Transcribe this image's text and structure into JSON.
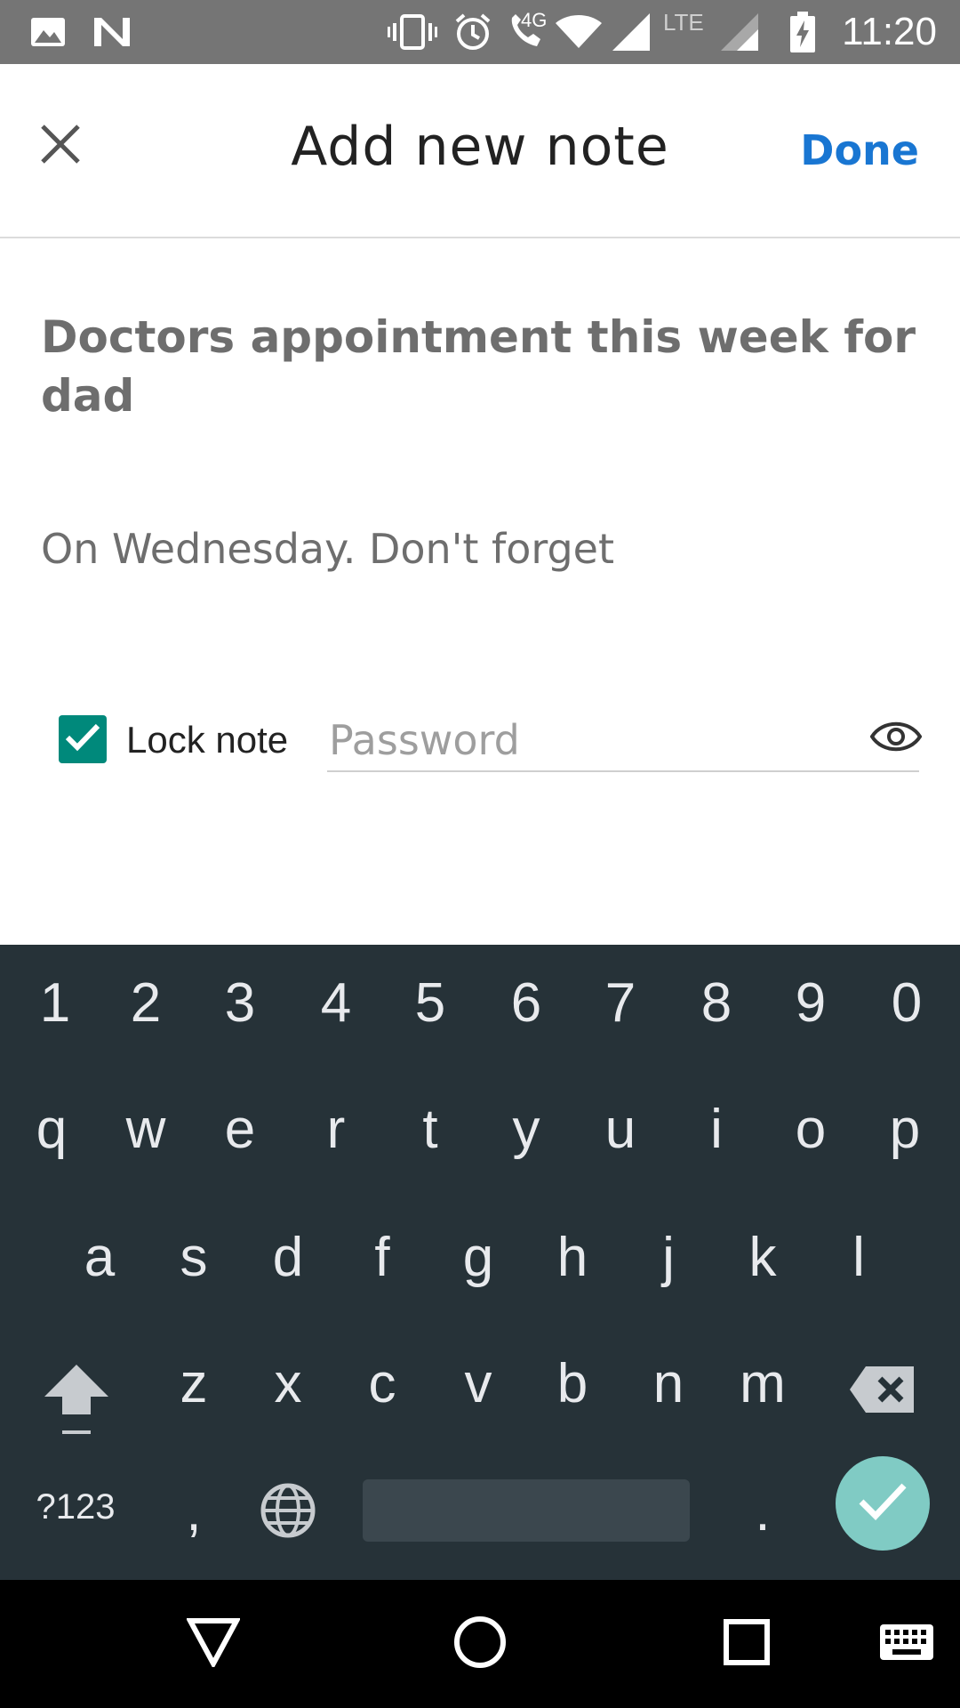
{
  "status_bar": {
    "time": "11:20",
    "network_label": "4G",
    "lte_label": "LTE",
    "icons": [
      "image-icon",
      "n-logo-icon",
      "vibrate-icon",
      "alarm-icon",
      "wifi-call-icon",
      "wifi-icon",
      "signal-icon",
      "lte-signal-icon",
      "battery-charging-icon"
    ]
  },
  "appbar": {
    "title": "Add new note",
    "done_label": "Done",
    "close_icon": "close-icon"
  },
  "note": {
    "title": "Doctors appointment this week for dad",
    "body": "On Wednesday. Don't forget"
  },
  "lock": {
    "checked": true,
    "label": "Lock note",
    "password_placeholder": "Password",
    "password_value": "",
    "visibility_icon": "eye-icon"
  },
  "keyboard": {
    "number_row": [
      "1",
      "2",
      "3",
      "4",
      "5",
      "6",
      "7",
      "8",
      "9",
      "0"
    ],
    "row1": [
      "q",
      "w",
      "e",
      "r",
      "t",
      "y",
      "u",
      "i",
      "o",
      "p"
    ],
    "row2": [
      "a",
      "s",
      "d",
      "f",
      "g",
      "h",
      "j",
      "k",
      "l"
    ],
    "row3": [
      "z",
      "x",
      "c",
      "v",
      "b",
      "n",
      "m"
    ],
    "symbols_label": "?123",
    "comma": ",",
    "period": ".",
    "icons": [
      "shift-icon",
      "backspace-icon",
      "globe-icon",
      "enter-check-icon"
    ]
  },
  "navbar": {
    "icons": [
      "back-icon",
      "home-icon",
      "recents-icon",
      "keyboard-switch-icon"
    ]
  },
  "colors": {
    "accent": "#1976d2",
    "checkbox": "#00897b",
    "keyboard_bg": "#263238",
    "enter_key": "#80cbc4",
    "status_bar": "#757575"
  }
}
